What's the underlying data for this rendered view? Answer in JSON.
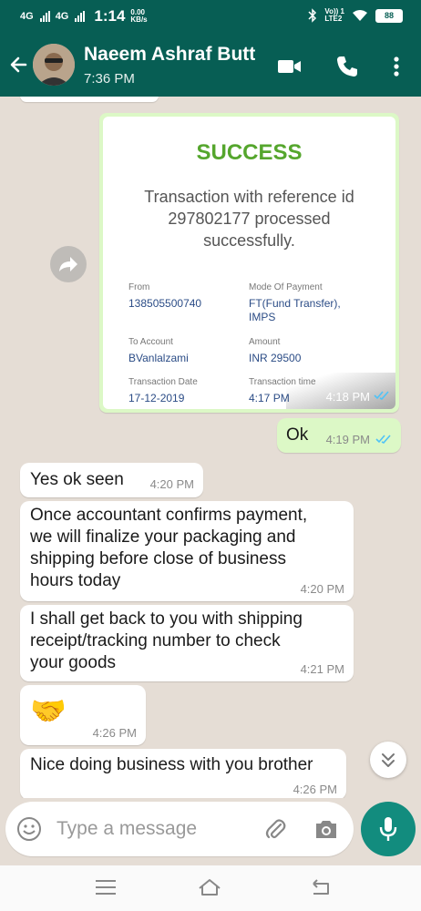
{
  "status_bar": {
    "net1": "4G",
    "net2": "4G",
    "time": "1:14",
    "speed_value": "0.00",
    "speed_unit": "KB/s",
    "volte": "Vo)) 1",
    "lte": "LTE2",
    "battery": "88"
  },
  "header": {
    "contact_name": "Naeem Ashraf Butt",
    "last_seen": "7:36 PM",
    "icons": [
      "back-arrow-icon",
      "video-call-icon",
      "voice-call-icon",
      "more-options-icon"
    ]
  },
  "receipt": {
    "status": "SUCCESS",
    "description": "Transaction with reference id 297802177 processed successfully.",
    "fields": {
      "from_label": "From",
      "from_value": "138505500740",
      "mode_label": "Mode Of Payment",
      "mode_value": "FT(Fund Transfer), IMPS",
      "to_label": "To Account",
      "to_value": "BVanlalzami",
      "amount_label": "Amount",
      "amount_value": "INR 29500",
      "date_label": "Transaction Date",
      "date_value": "17-12-2019",
      "txtime_label": "Transaction time",
      "txtime_value": "4:17 PM"
    },
    "time": "4:18 PM"
  },
  "messages": [
    {
      "direction": "out",
      "text": "Ok",
      "time": "4:19 PM"
    },
    {
      "direction": "in",
      "text": "Yes ok seen",
      "time": "4:20 PM"
    },
    {
      "direction": "in",
      "lines": [
        "Once accountant confirms payment,",
        "we will finalize your packaging and",
        "shipping before close of business",
        "hours today"
      ],
      "time": "4:20 PM"
    },
    {
      "direction": "in",
      "lines": [
        "I shall get back to you with shipping",
        "receipt/tracking number to check",
        "your goods"
      ],
      "time": "4:21 PM"
    },
    {
      "direction": "in",
      "text": "🤝",
      "time": "4:26 PM"
    },
    {
      "direction": "in",
      "text": "Nice doing business with you brother",
      "time": "4:26 PM"
    }
  ],
  "input": {
    "placeholder": "Type a message"
  },
  "colors": {
    "header": "#075e54",
    "outgoing_bubble": "#dcf8c6",
    "incoming_bubble": "#ffffff",
    "chat_background": "#e5ddd5",
    "mic_button": "#128c7e",
    "read_ticks": "#4fc3f7",
    "success_green": "#55a62d"
  }
}
